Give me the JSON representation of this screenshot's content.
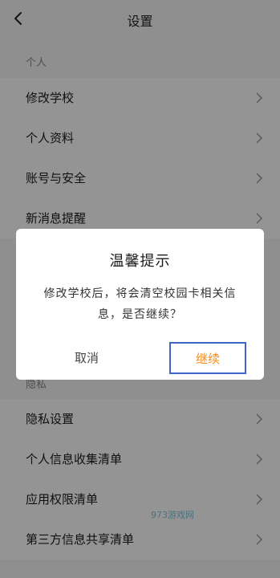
{
  "header": {
    "title": "设置",
    "back_icon": "chevron-left-icon"
  },
  "sections": [
    {
      "header": "个人",
      "items": [
        {
          "label": "修改学校"
        },
        {
          "label": "个人资料"
        },
        {
          "label": "账号与安全"
        },
        {
          "label": "新消息提醒"
        }
      ]
    },
    {
      "header": "隐私",
      "items": [
        {
          "label": "隐私设置"
        },
        {
          "label": "个人信息收集清单"
        },
        {
          "label": "应用权限清单"
        },
        {
          "label": "第三方信息共享清单"
        }
      ]
    }
  ],
  "watermark": "973游戏网",
  "dialog": {
    "title": "温馨提示",
    "message": "修改学校后，将会清空校园卡相关信息，是否继续？",
    "cancel_label": "取消",
    "continue_label": "继续"
  },
  "colors": {
    "accent": "#f08c1f",
    "highlight_border": "#3f63c8",
    "overlay": "rgba(0,0,0,0.42)"
  }
}
